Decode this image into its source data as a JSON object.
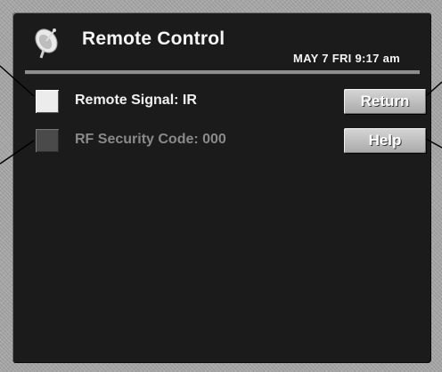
{
  "header": {
    "title": "Remote Control",
    "datetime": "MAY  7 FRI  9:17 am",
    "icon": "satellite-dish-icon"
  },
  "options": [
    {
      "label": "Remote Signal:  IR",
      "selected": true
    },
    {
      "label": "RF Security Code:  000",
      "selected": false
    }
  ],
  "buttons": {
    "return_label": "Return",
    "help_label": "Help"
  },
  "colors": {
    "background": "#1b1b1b",
    "frame": "#a8a8a8",
    "text": "#f0f0f0",
    "disabled_text": "#8a8a8a",
    "button": "#bdbdbd"
  }
}
